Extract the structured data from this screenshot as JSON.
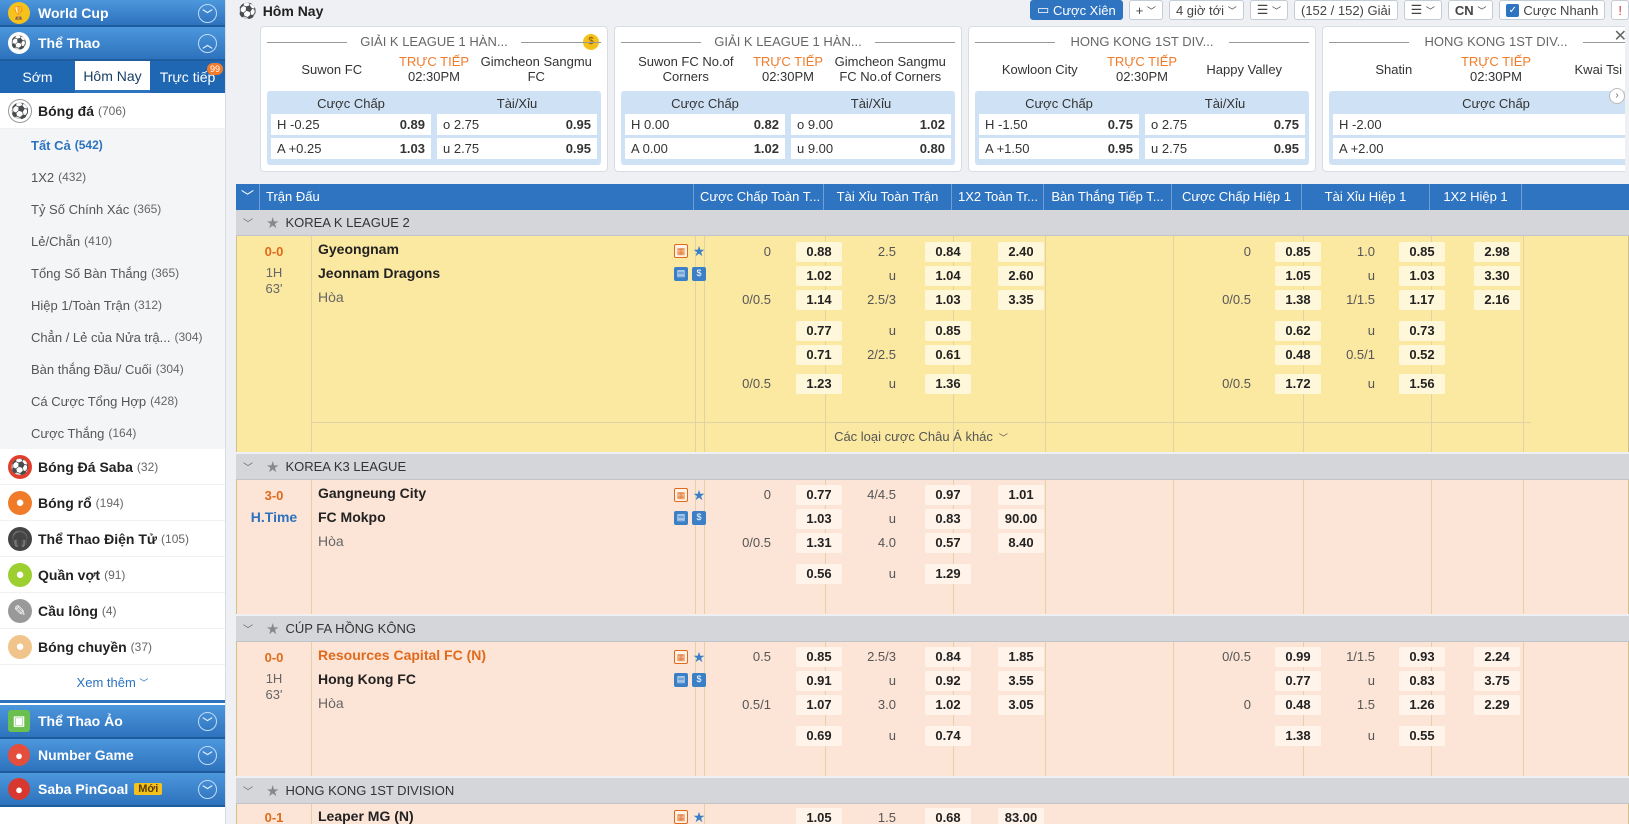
{
  "sidebar": {
    "world_cup": "World Cup",
    "sports": "Thể Thao",
    "tabs": {
      "early": "Sớm",
      "today": "Hôm Nay",
      "live": "Trực tiếp",
      "live_badge": "99"
    },
    "football": {
      "label": "Bóng đá",
      "count": "(706)"
    },
    "sub": [
      {
        "label": "Tất Cả",
        "count": "(542)"
      },
      {
        "label": "1X2",
        "count": "(432)"
      },
      {
        "label": "Tỷ Số Chính Xác",
        "count": "(365)"
      },
      {
        "label": "Lẻ/Chẵn",
        "count": "(410)"
      },
      {
        "label": "Tổng Số Bàn Thắng",
        "count": "(365)"
      },
      {
        "label": "Hiệp 1/Toàn Trận",
        "count": "(312)"
      },
      {
        "label": "Chẳn / Lẻ của Nửa trậ...",
        "count": "(304)"
      },
      {
        "label": "Bàn thắng Đầu/ Cuối",
        "count": "(304)"
      },
      {
        "label": "Cá Cược Tổng Hợp",
        "count": "(428)"
      },
      {
        "label": "Cược Thắng",
        "count": "(164)"
      }
    ],
    "other": [
      {
        "label": "Bóng Đá Saba",
        "count": "(32)"
      },
      {
        "label": "Bóng rổ",
        "count": "(194)"
      },
      {
        "label": "Thể Thao Điện Tử",
        "count": "(105)"
      },
      {
        "label": "Quần vợt",
        "count": "(91)"
      },
      {
        "label": "Cầu lông",
        "count": "(4)"
      },
      {
        "label": "Bóng chuyền",
        "count": "(37)"
      }
    ],
    "more": "Xem thêm",
    "virtual": "Thể Thao Ảo",
    "number_game": "Number Game",
    "pingoal": "Saba PinGoal",
    "new_badge": "Mới"
  },
  "topbar": {
    "title": "Hôm Nay",
    "parlay": "Cược Xiên",
    "plus": "+",
    "time": "4 giờ tới",
    "count": "(152 / 152) Giải",
    "lang": "CN",
    "quick": "Cược Nhanh"
  },
  "cards": [
    {
      "league": "GIẢI K LEAGUE 1 HÀN...",
      "home": "Suwon FC",
      "away": "Gimcheon Sangmu FC",
      "live": "TRỰC TIẾP",
      "time": "02:30PM",
      "h1": "Cược Chấp",
      "h2": "Tài/Xỉu",
      "r1l": "H -0.25",
      "r1v": "0.89",
      "r1r": "o 2.75",
      "r1rv": "0.95",
      "r2l": "A +0.25",
      "r2v": "1.03",
      "r2r": "u 2.75",
      "r2rv": "0.95"
    },
    {
      "league": "GIẢI K LEAGUE 1 HÀN...",
      "home": "Suwon FC No.of Corners",
      "away": "Gimcheon Sangmu FC No.of Corners",
      "live": "TRỰC TIẾP",
      "time": "02:30PM",
      "h1": "Cược Chấp",
      "h2": "Tài/Xỉu",
      "r1l": "H 0.00",
      "r1v": "0.82",
      "r1r": "o 9.00",
      "r1rv": "1.02",
      "r2l": "A 0.00",
      "r2v": "1.02",
      "r2r": "u 9.00",
      "r2rv": "0.80"
    },
    {
      "league": "HONG KONG 1ST DIV...",
      "home": "Kowloon City",
      "away": "Happy Valley",
      "live": "TRỰC TIẾP",
      "time": "02:30PM",
      "h1": "Cược Chấp",
      "h2": "Tài/Xỉu",
      "r1l": "H -1.50",
      "r1v": "0.75",
      "r1r": "o 2.75",
      "r1rv": "0.75",
      "r2l": "A +1.50",
      "r2v": "0.95",
      "r2r": "u 2.75",
      "r2rv": "0.95"
    },
    {
      "league": "HONG KONG 1ST DIV...",
      "home": "Shatin",
      "away": "Kwai Tsi",
      "live": "TRỰC TIẾP",
      "time": "02:30PM",
      "h1": "Cược Chấp",
      "r1l": "H -2.00",
      "r2l": "A +2.00"
    }
  ],
  "table_headers": [
    "Trận Đấu",
    "Cược Chấp Toàn T...",
    "Tài Xỉu Toàn Trận",
    "1X2 Toàn Tr...",
    "Bàn Thắng Tiếp T...",
    "Cược Chấp Hiệp 1",
    "Tài Xỉu Hiệp 1",
    "1X2 Hiệp 1"
  ],
  "leagues": [
    "KOREA K LEAGUE 2",
    "KOREA K3 LEAGUE",
    "CÚP FA HỒNG KÔNG",
    "HONG KONG 1ST DIVISION"
  ],
  "draw": "Hòa",
  "more_asian": "Các loại cược Châu Á khác",
  "m1": {
    "score": "0-0",
    "period": "1H",
    "minute": "63'",
    "home": "Gyeongnam",
    "away": "Jeonnam Dragons",
    "ah": [
      [
        "0",
        "0.88"
      ],
      [
        "",
        "1.02"
      ],
      [
        "0/0.5",
        "1.14"
      ],
      [
        "",
        "0.77"
      ],
      [
        "",
        "0.71"
      ],
      [
        "0/0.5",
        "1.23"
      ]
    ],
    "ou": [
      [
        "2.5",
        "0.84"
      ],
      [
        "u",
        "1.04"
      ],
      [
        "2.5/3",
        "1.03"
      ],
      [
        "u",
        "0.85"
      ],
      [
        "2/2.5",
        "0.61"
      ],
      [
        "u",
        "1.36"
      ]
    ],
    "x12": [
      "2.40",
      "2.60",
      "3.35"
    ],
    "ah1": [
      [
        "0",
        "0.85"
      ],
      [
        "",
        "1.05"
      ],
      [
        "0/0.5",
        "1.38"
      ],
      [
        "",
        "0.62"
      ],
      [
        "",
        "0.48"
      ],
      [
        "0/0.5",
        "1.72"
      ]
    ],
    "ou1": [
      [
        "1.0",
        "0.85"
      ],
      [
        "u",
        "1.03"
      ],
      [
        "1/1.5",
        "1.17"
      ],
      [
        "u",
        "0.73"
      ],
      [
        "0.5/1",
        "0.52"
      ],
      [
        "u",
        "1.56"
      ]
    ],
    "x121": [
      "2.98",
      "3.30",
      "2.16"
    ]
  },
  "m2": {
    "score": "3-0",
    "period": "H.Time",
    "home": "Gangneung City",
    "away": "FC Mokpo",
    "ah": [
      [
        "0",
        "0.77"
      ],
      [
        "",
        "1.03"
      ],
      [
        "0/0.5",
        "1.31"
      ],
      [
        "",
        "0.56"
      ]
    ],
    "ou": [
      [
        "4/4.5",
        "0.97"
      ],
      [
        "u",
        "0.83"
      ],
      [
        "4.0",
        "0.57"
      ],
      [
        "u",
        "1.29"
      ]
    ],
    "x12": [
      "1.01",
      "90.00",
      "8.40"
    ]
  },
  "m3": {
    "score": "0-0",
    "period": "1H",
    "minute": "63'",
    "home": "Resources Capital FC (N)",
    "away": "Hong Kong FC",
    "ah": [
      [
        "0.5",
        "0.85"
      ],
      [
        "",
        "0.91"
      ],
      [
        "0.5/1",
        "1.07"
      ],
      [
        "",
        "0.69"
      ]
    ],
    "ou": [
      [
        "2.5/3",
        "0.84"
      ],
      [
        "u",
        "0.92"
      ],
      [
        "3.0",
        "1.02"
      ],
      [
        "u",
        "0.74"
      ]
    ],
    "x12": [
      "1.85",
      "3.55",
      "3.05"
    ],
    "ah1": [
      [
        "0/0.5",
        "0.99"
      ],
      [
        "",
        "0.77"
      ],
      [
        "0",
        "0.48"
      ],
      [
        "",
        "1.38"
      ]
    ],
    "ou1": [
      [
        "1/1.5",
        "0.93"
      ],
      [
        "u",
        "0.83"
      ],
      [
        "1.5",
        "1.26"
      ],
      [
        "u",
        "0.55"
      ]
    ],
    "x121": [
      "2.24",
      "3.75",
      "2.29"
    ]
  },
  "m4": {
    "score": "0-1",
    "home": "Leaper MG (N)",
    "ah": [
      "1.05"
    ],
    "ou": [
      "1.5",
      "0.68"
    ],
    "x12": [
      "83.00"
    ]
  }
}
